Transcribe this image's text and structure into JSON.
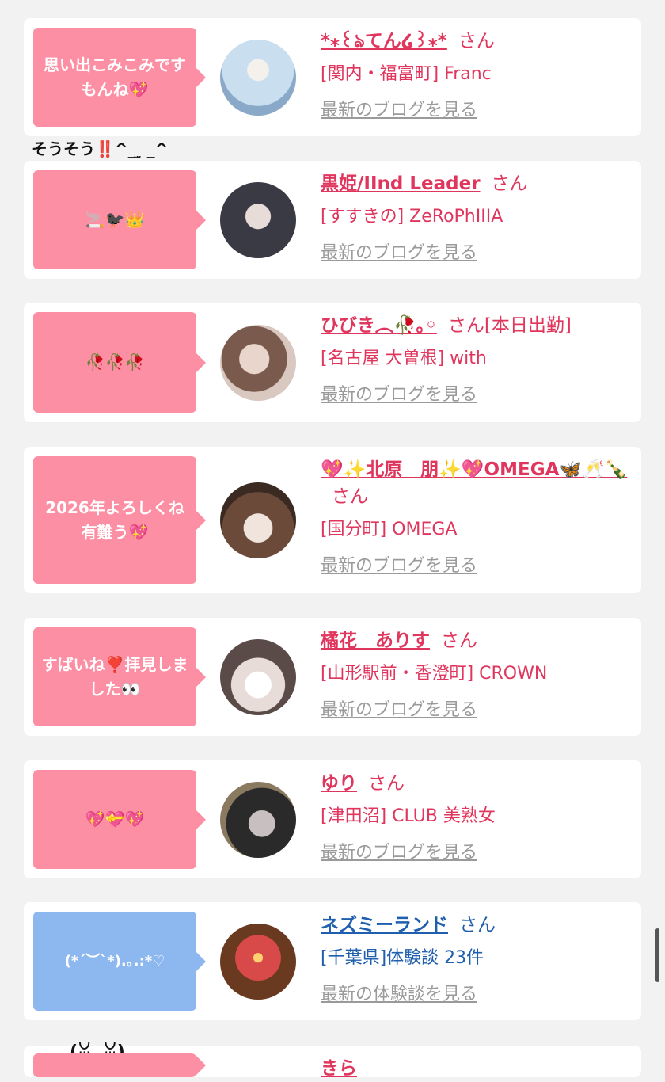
{
  "entries": [
    {
      "bubble": "思い出こみこみですもんね💖",
      "name": "*⁎꒰ঌてん໒꒱⁎*",
      "san": "さん",
      "shop": "[関内・福富町] Franc",
      "link": "最新のブログを見る",
      "bubble_color": "#fd8fa4",
      "avatar_colors": [
        "#c9dff0",
        "#8aa8c8"
      ]
    },
    {
      "bubble": "🚬🐦‍⬛👑",
      "name": "黒姫/IInd Leader",
      "san": "さん",
      "shop": "[すすきの] ZeRoPhIIIA",
      "link": "最新のブログを見る",
      "bubble_color": "#fd8fa4",
      "avatar_colors": [
        "#3a3a44",
        "#9a96a8"
      ]
    },
    {
      "bubble": "🥀🥀🥀",
      "name": "ひびき︵🥀｡◦",
      "san": "さん[本日出勤]",
      "shop": "[名古屋 大曽根] with",
      "link": "最新のブログを見る",
      "bubble_color": "#fd8fa4",
      "avatar_colors": [
        "#e8d6cc",
        "#7a5a4c"
      ]
    },
    {
      "bubble": "2026年よろしくね有難う💖",
      "name": "💖✨北原　朋✨💖OMEGA🦋🥂🍾",
      "san": "さん",
      "shop": "[国分町] OMEGA",
      "link": "最新のブログを見る",
      "bubble_color": "#fd8fa4",
      "avatar_colors": [
        "#6b4a3a",
        "#d8b8a8"
      ]
    },
    {
      "bubble": "すばいね❣️拝見しました👀",
      "name": "橘花　ありす",
      "san": "さん",
      "shop": "[山形駅前・香澄町] CROWN",
      "link": "最新のブログを見る",
      "bubble_color": "#fd8fa4",
      "avatar_colors": [
        "#5a4a48",
        "#e8dcd8"
      ]
    },
    {
      "bubble": "💖💝💖",
      "name": "ゆり",
      "san": "さん",
      "shop": "[津田沼] CLUB 美熟女",
      "link": "最新のブログを見る",
      "bubble_color": "#fd8fa4",
      "avatar_colors": [
        "#2a2a2a",
        "#c8c0c0"
      ]
    },
    {
      "bubble": "(*´︶`*).｡.:*♡",
      "name": "ネズミーランド",
      "san": "さん",
      "shop": "[千葉県]体験談 23件",
      "link": "最新の体験談を見る",
      "bubble_color": "#8db7ef",
      "avatar_colors": [
        "#d84a4a",
        "#6a3a20"
      ]
    }
  ],
  "remark": {
    "text": "そうそう",
    "bang": "‼️",
    "face": "^_ ̫ _^"
  },
  "partial": {
    "emoticon": "(ꈍ ̫ ꈍ)",
    "name": "きら"
  }
}
